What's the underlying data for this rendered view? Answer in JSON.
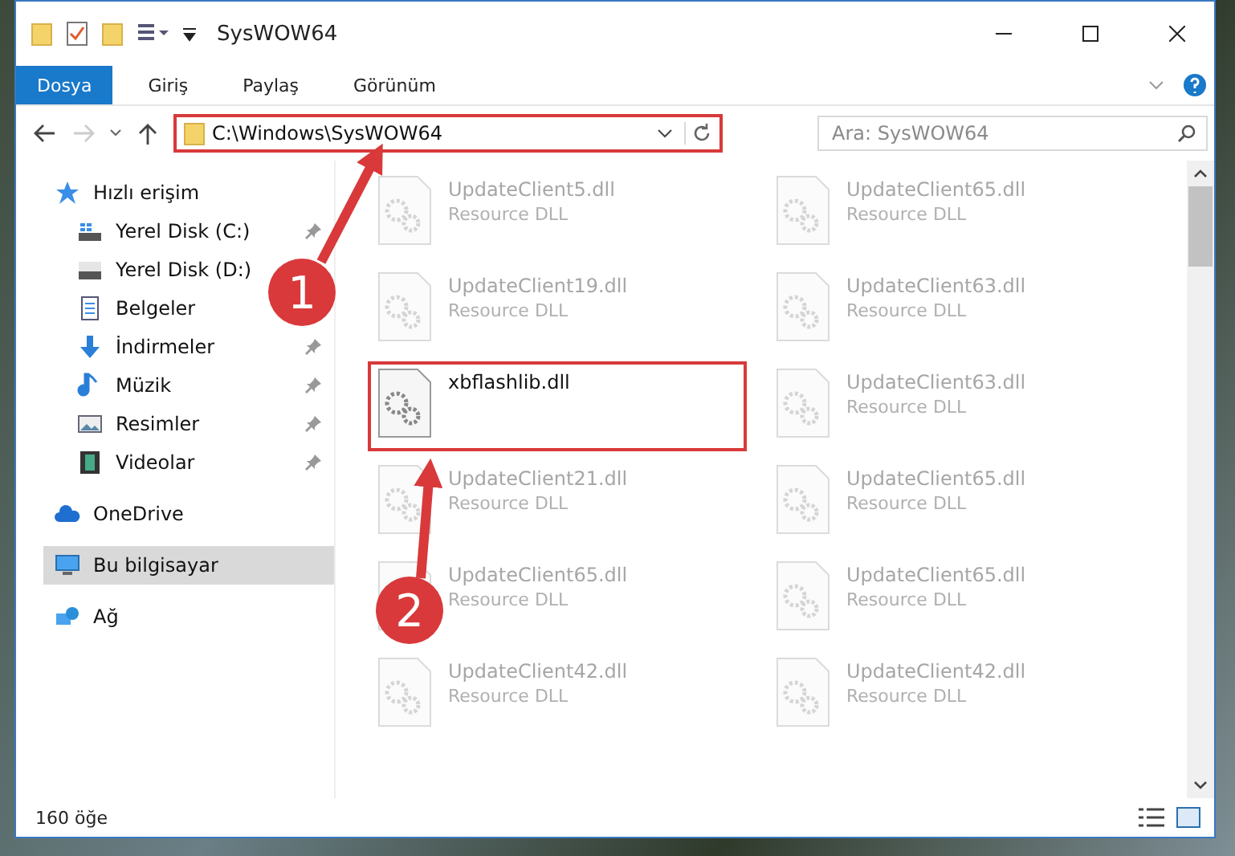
{
  "window": {
    "title": "SysWOW64"
  },
  "ribbon_tabs": [
    {
      "label": "Dosya",
      "kind": "file"
    },
    {
      "label": "Giriş",
      "kind": "tab"
    },
    {
      "label": "Paylaş",
      "kind": "tab"
    },
    {
      "label": "Görünüm",
      "kind": "tab"
    }
  ],
  "address_bar": {
    "path": "C:\\Windows\\SysWOW64",
    "annotated": true
  },
  "search": {
    "placeholder": "Ara: SysWOW64"
  },
  "sidebar": {
    "items": [
      {
        "label": "Hızlı erişim",
        "kind": "star",
        "selected": false,
        "children": [
          {
            "label": "Yerel Disk (C:)",
            "kind": "systemdrive",
            "pinned": true,
            "selected": false
          },
          {
            "label": "Yerel Disk (D:)",
            "kind": "drive",
            "pinned": false,
            "selected": false
          },
          {
            "label": "Belgeler",
            "kind": "document",
            "pinned": false,
            "selected": false
          },
          {
            "label": "İndirmeler",
            "kind": "download",
            "pinned": true,
            "selected": false
          },
          {
            "label": "Müzik",
            "kind": "music",
            "pinned": true,
            "selected": false
          },
          {
            "label": "Resimler",
            "kind": "picture",
            "pinned": true,
            "selected": false
          },
          {
            "label": "Videolar",
            "kind": "video",
            "pinned": true,
            "selected": false
          }
        ]
      },
      {
        "label": "OneDrive",
        "kind": "cloud",
        "selected": false
      },
      {
        "label": "Bu bilgisayar",
        "kind": "computer",
        "selected": true
      },
      {
        "label": "Ağ",
        "kind": "network",
        "selected": false
      }
    ]
  },
  "files": [
    {
      "name": "UpdateClient5.dll",
      "type": "Resource DLL",
      "faded": true,
      "annotated": false
    },
    {
      "name": "UpdateClient65.dll",
      "type": "Resource DLL",
      "faded": true,
      "annotated": false
    },
    {
      "name": "UpdateClient19.dll",
      "type": "Resource DLL",
      "faded": true,
      "annotated": false
    },
    {
      "name": "UpdateClient63.dll",
      "type": "Resource DLL",
      "faded": true,
      "annotated": false
    },
    {
      "name": "xbflashlib.dll",
      "faded": false,
      "annotated": true
    },
    {
      "name": "UpdateClient63.dll",
      "type": "Resource DLL",
      "faded": true,
      "annotated": false
    },
    {
      "name": "UpdateClient21.dll",
      "type": "Resource DLL",
      "faded": true,
      "annotated": false
    },
    {
      "name": "UpdateClient65.dll",
      "type": "Resource DLL",
      "faded": true,
      "annotated": false
    },
    {
      "name": "UpdateClient65.dll",
      "type": "Resource DLL",
      "faded": true,
      "annotated": false
    },
    {
      "name": "UpdateClient65.dll",
      "type": "Resource DLL",
      "faded": true,
      "annotated": false
    },
    {
      "name": "UpdateClient42.dll",
      "type": "Resource DLL",
      "faded": true,
      "annotated": false
    },
    {
      "name": "UpdateClient42.dll",
      "type": "Resource DLL",
      "faded": true,
      "annotated": false
    }
  ],
  "status_bar": {
    "count": "160 öğe"
  },
  "annotations": [
    {
      "number": "1"
    },
    {
      "number": "2"
    }
  ]
}
